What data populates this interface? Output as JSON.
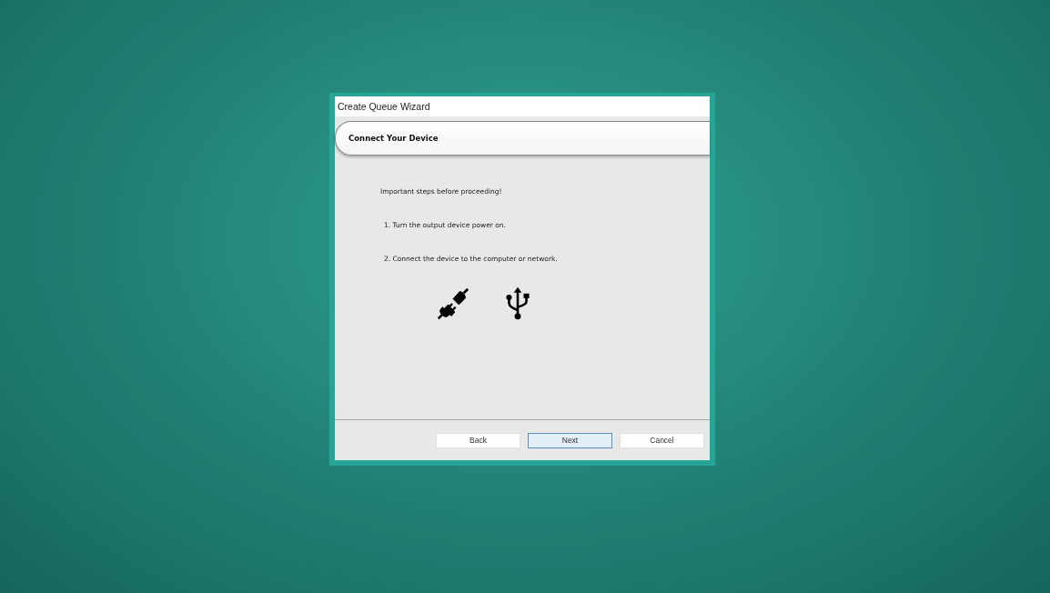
{
  "window": {
    "title": "Create Queue Wizard"
  },
  "header": {
    "title": "Connect Your Device"
  },
  "intro": "Important steps before proceeding!",
  "steps": [
    "1. Turn the output device power on.",
    "2. Connect the device to the computer or network."
  ],
  "buttons": [
    {
      "label": "Back",
      "focused": false
    },
    {
      "label": "Next",
      "focused": true
    },
    {
      "label": "Cancel",
      "focused": false
    }
  ]
}
